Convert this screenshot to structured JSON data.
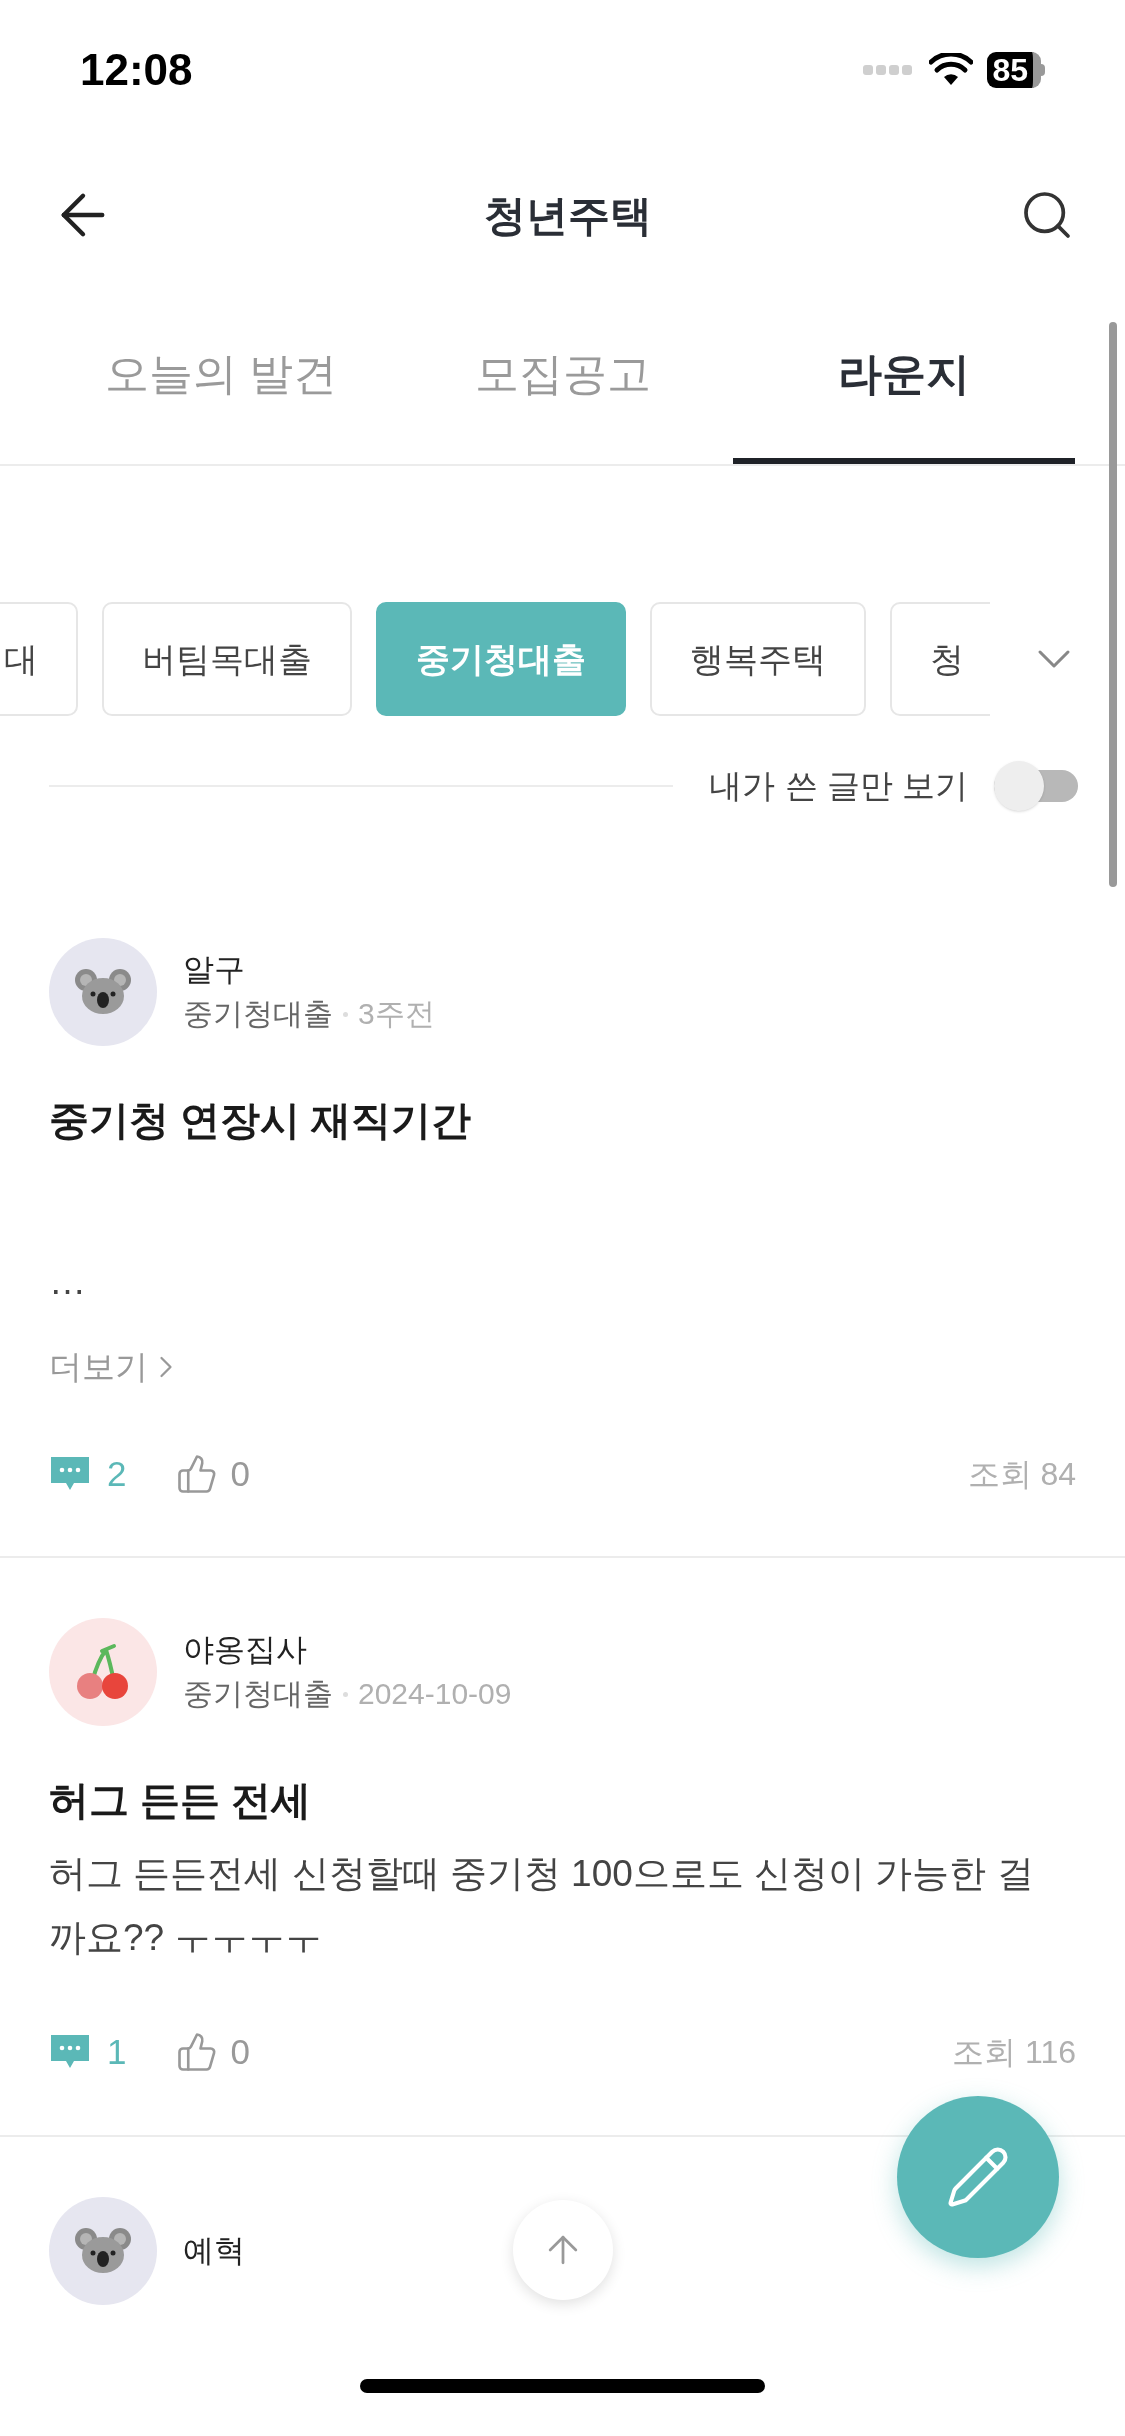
{
  "status_bar": {
    "time": "12:08",
    "battery": "85"
  },
  "header": {
    "title": "청년주택"
  },
  "tabs": [
    {
      "label": "오늘의 발견",
      "selected": false
    },
    {
      "label": "모집공고",
      "selected": false
    },
    {
      "label": "라운지",
      "selected": true
    }
  ],
  "chips": [
    {
      "label": "대",
      "selected": false
    },
    {
      "label": "버팀목대출",
      "selected": false
    },
    {
      "label": "중기청대출",
      "selected": true
    },
    {
      "label": "행복주택",
      "selected": false
    },
    {
      "label": "청",
      "selected": false
    }
  ],
  "my_posts_filter": {
    "label": "내가 쓴 글만 보기",
    "on": false
  },
  "posts": [
    {
      "author": "알구",
      "avatar": {
        "kind": "koala"
      },
      "category": "중기청대출",
      "time": "3주전",
      "title": "중기청 연장시 재직기간",
      "body": "…",
      "more": "더보기",
      "comments": "2",
      "likes": "0",
      "views": "조회 84"
    },
    {
      "author": "야옹집사",
      "avatar": {
        "kind": "cherry"
      },
      "category": "중기청대출",
      "time": "2024-10-09",
      "title": "허그 든든 전세",
      "body": "허그 든든전세 신청할때 중기청 100으로도 신청이 가능한 걸까요?? ㅜㅜㅜㅜ",
      "comments": "1",
      "likes": "0",
      "views": "조회 116"
    },
    {
      "author": "예혁",
      "avatar": {
        "kind": "koala"
      }
    }
  ]
}
